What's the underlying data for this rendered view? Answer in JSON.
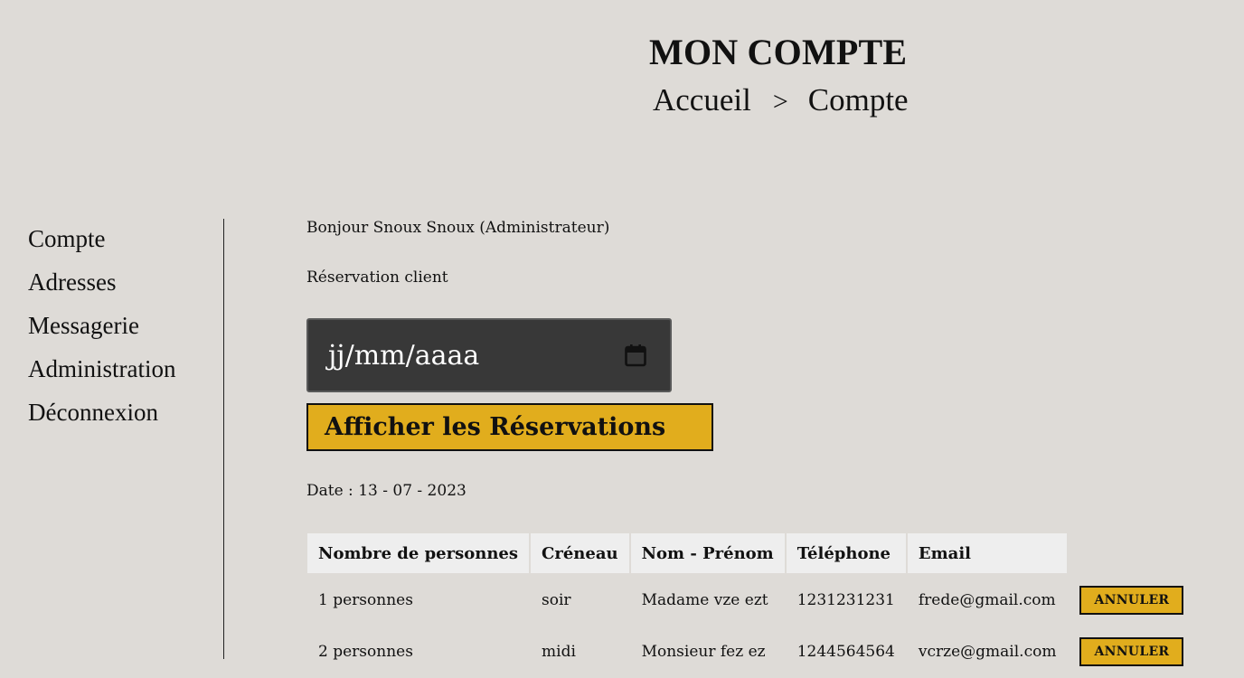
{
  "header": {
    "title": "MON COMPTE",
    "breadcrumb": {
      "home": "Accueil",
      "separator": ">",
      "current": "Compte"
    }
  },
  "sidebar": {
    "items": [
      {
        "label": "Compte"
      },
      {
        "label": "Adresses"
      },
      {
        "label": "Messagerie"
      },
      {
        "label": "Administration"
      },
      {
        "label": "Déconnexion"
      }
    ]
  },
  "main": {
    "greeting": "Bonjour Snoux Snoux (Administrateur)",
    "section_label": "Réservation client",
    "date_input": {
      "placeholder": "jj/mm/aaaa"
    },
    "show_button_label": "Afficher les Réservations",
    "date_label": "Date : 13 - 07 - 2023",
    "table": {
      "headers": [
        "Nombre de personnes",
        "Créneau",
        "Nom - Prénom",
        "Téléphone",
        "Email"
      ],
      "rows": [
        {
          "persons": "1 personnes",
          "slot": "soir",
          "name": "Madame vze ezt",
          "phone": "1231231231",
          "email": "frede@gmail.com",
          "action": "ANNULER"
        },
        {
          "persons": "2 personnes",
          "slot": "midi",
          "name": "Monsieur fez ez",
          "phone": "1244564564",
          "email": "vcrze@gmail.com",
          "action": "ANNULER"
        }
      ]
    }
  },
  "colors": {
    "background": "#dedbd7",
    "accent": "#e1ad1d",
    "input_background": "#383838",
    "table_header_background": "#eeeeee"
  },
  "icons": {
    "date_picker": "calendar-icon"
  }
}
